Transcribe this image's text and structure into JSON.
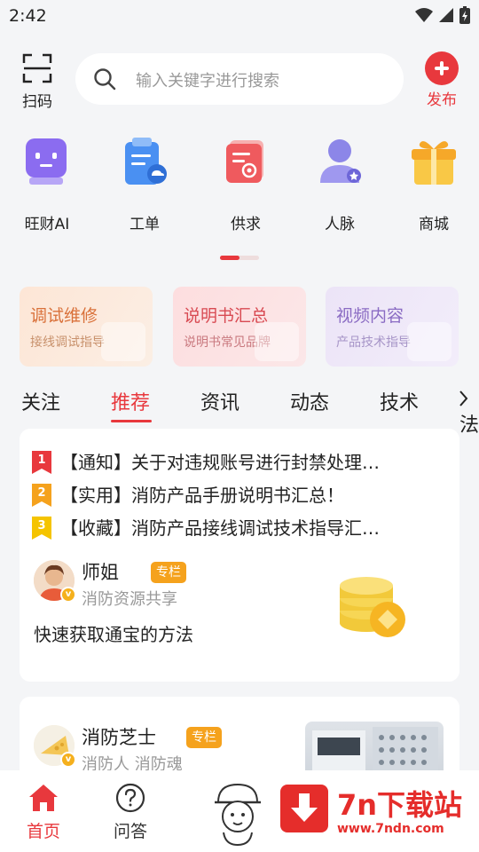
{
  "status_bar": {
    "time": "2:42"
  },
  "header": {
    "scan_label": "扫码",
    "search_placeholder": "输入关键字进行搜索",
    "publish_label": "发布"
  },
  "quick_menu": [
    {
      "label": "旺财AI",
      "icon": "robot-icon"
    },
    {
      "label": "工单",
      "icon": "clipboard-icon"
    },
    {
      "label": "供求",
      "icon": "supply-demand-icon"
    },
    {
      "label": "人脉",
      "icon": "contacts-icon"
    },
    {
      "label": "商城",
      "icon": "gift-icon"
    }
  ],
  "feature_cards": [
    {
      "title": "调试维修",
      "subtitle": "接线调试指导"
    },
    {
      "title": "说明书汇总",
      "subtitle": "说明书常见品牌"
    },
    {
      "title": "视频内容",
      "subtitle": "产品技术指导"
    }
  ],
  "tabs": [
    "关注",
    "推荐",
    "资讯",
    "动态",
    "技术",
    "法"
  ],
  "active_tab": "推荐",
  "notices": [
    {
      "rank": "1",
      "text": "【通知】关于对违规账号进行封禁处理…",
      "color": "#e8383d"
    },
    {
      "rank": "2",
      "text": "【实用】消防产品手册说明书汇总！",
      "color": "#f5a21d"
    },
    {
      "rank": "3",
      "text": "【收藏】消防产品接线调试技术指导汇…",
      "color": "#f5c400"
    }
  ],
  "post_1": {
    "author": "师姐",
    "tag": "专栏",
    "author_subtitle": "消防资源共享",
    "title": "快速获取通宝的方法",
    "badge": "v"
  },
  "post_2": {
    "author": "消防芝士",
    "tag": "专栏",
    "author_subtitle": "消防人 消防魂",
    "badge": "v"
  },
  "bottom_nav": {
    "home_label": "首页",
    "qa_label": "问答"
  },
  "watermark": {
    "title": "7n下载站",
    "url": "www.7ndn.com"
  },
  "colors": {
    "accent": "#e8383d",
    "tag": "#f5a21d",
    "background": "#f4f5f7"
  }
}
